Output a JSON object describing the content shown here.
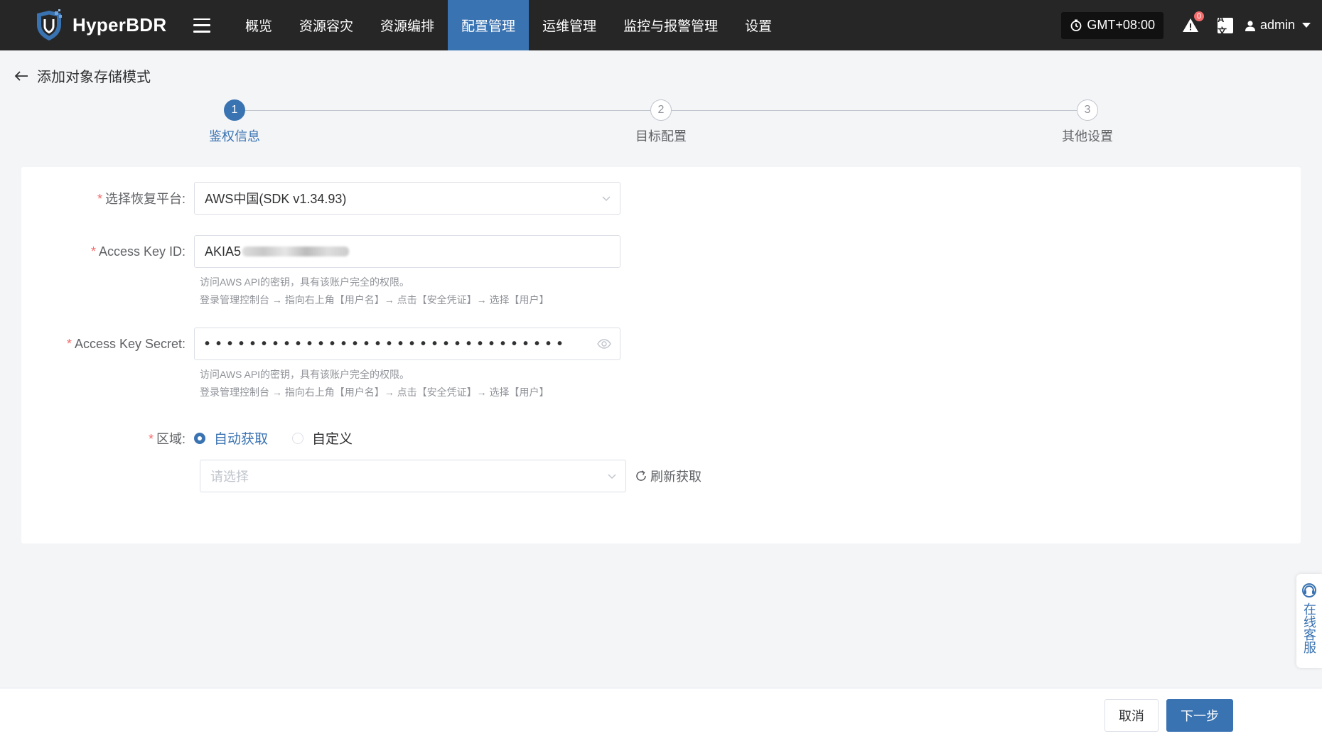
{
  "app": {
    "name": "HyperBDR"
  },
  "nav": {
    "items": [
      {
        "label": "概览",
        "active": false
      },
      {
        "label": "资源容灾",
        "active": false
      },
      {
        "label": "资源编排",
        "active": false
      },
      {
        "label": "配置管理",
        "active": true
      },
      {
        "label": "运维管理",
        "active": false
      },
      {
        "label": "监控与报警管理",
        "active": false
      },
      {
        "label": "设置",
        "active": false
      }
    ]
  },
  "topbar": {
    "timezone": "GMT+08:00",
    "alert_count": "0",
    "lang_icon": "A文",
    "user": "admin"
  },
  "page": {
    "title": "添加对象存储模式"
  },
  "steps": [
    {
      "number": "1",
      "label": "鉴权信息",
      "active": true
    },
    {
      "number": "2",
      "label": "目标配置",
      "active": false
    },
    {
      "number": "3",
      "label": "其他设置",
      "active": false
    }
  ],
  "form": {
    "required_mark": "*",
    "platform": {
      "label": "选择恢复平台:",
      "value": "AWS中国(SDK v1.34.93)"
    },
    "access_key_id": {
      "label": "Access Key ID:",
      "value_visible": "AKIA5",
      "help_line1": "访问AWS API的密钥，具有该账户完全的权限。",
      "help_line2": "登录管理控制台 → 指向右上角【用户名】→ 点击【安全凭证】→ 选择【用户】"
    },
    "access_key_secret": {
      "label": "Access Key Secret:",
      "masked_value": "••••••••••••••••••••••••••••••••",
      "help_line1": "访问AWS API的密钥，具有该账户完全的权限。",
      "help_line2": "登录管理控制台 → 指向右上角【用户名】→ 点击【安全凭证】→ 选择【用户】"
    },
    "region": {
      "label": "区域:",
      "options": [
        {
          "label": "自动获取",
          "checked": true
        },
        {
          "label": "自定义",
          "checked": false
        }
      ],
      "select_placeholder": "请选择",
      "refresh_label": "刷新获取"
    }
  },
  "footer": {
    "cancel_label": "取消",
    "next_label": "下一步"
  },
  "support": {
    "label": "在线客服"
  },
  "colors": {
    "primary": "#3a73b2",
    "topbar": "#262626",
    "required": "#f56c6c"
  }
}
